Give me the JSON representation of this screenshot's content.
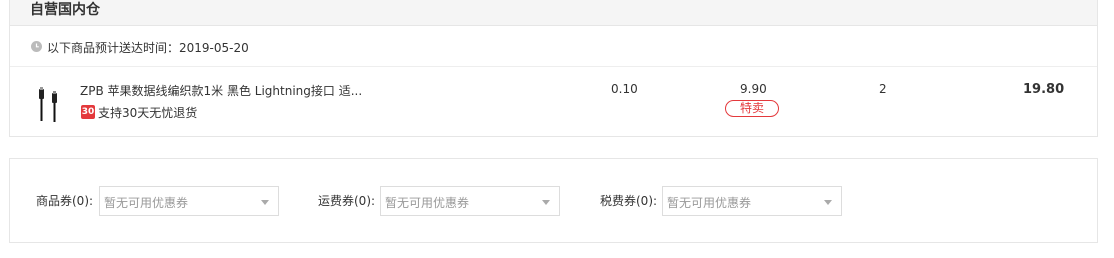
{
  "warehouse": {
    "title": "自营国内仓",
    "delivery_text": "以下商品预计送达时间：2019-05-20",
    "icons": {
      "clock": "clock-icon"
    }
  },
  "product": {
    "name": "ZPB 苹果数据线编织款1米 黑色 Lightning接口 适...",
    "return_badge": "30",
    "return_text": "支持30天无忧退货",
    "weight": "0.10",
    "price": "9.90",
    "special_tag": "特卖",
    "quantity": "2",
    "subtotal": "19.80",
    "image": "usb-cable-image"
  },
  "coupons": [
    {
      "label": "商品券(0):",
      "placeholder": "暂无可用优惠券"
    },
    {
      "label": "运费券(0):",
      "placeholder": "暂无可用优惠券"
    },
    {
      "label": "税费券(0):",
      "placeholder": "暂无可用优惠券"
    }
  ],
  "colors": {
    "accent_red": "#e4393c",
    "border": "#e6e6e6",
    "header_bg": "#f5f5f5",
    "placeholder": "#999999"
  }
}
